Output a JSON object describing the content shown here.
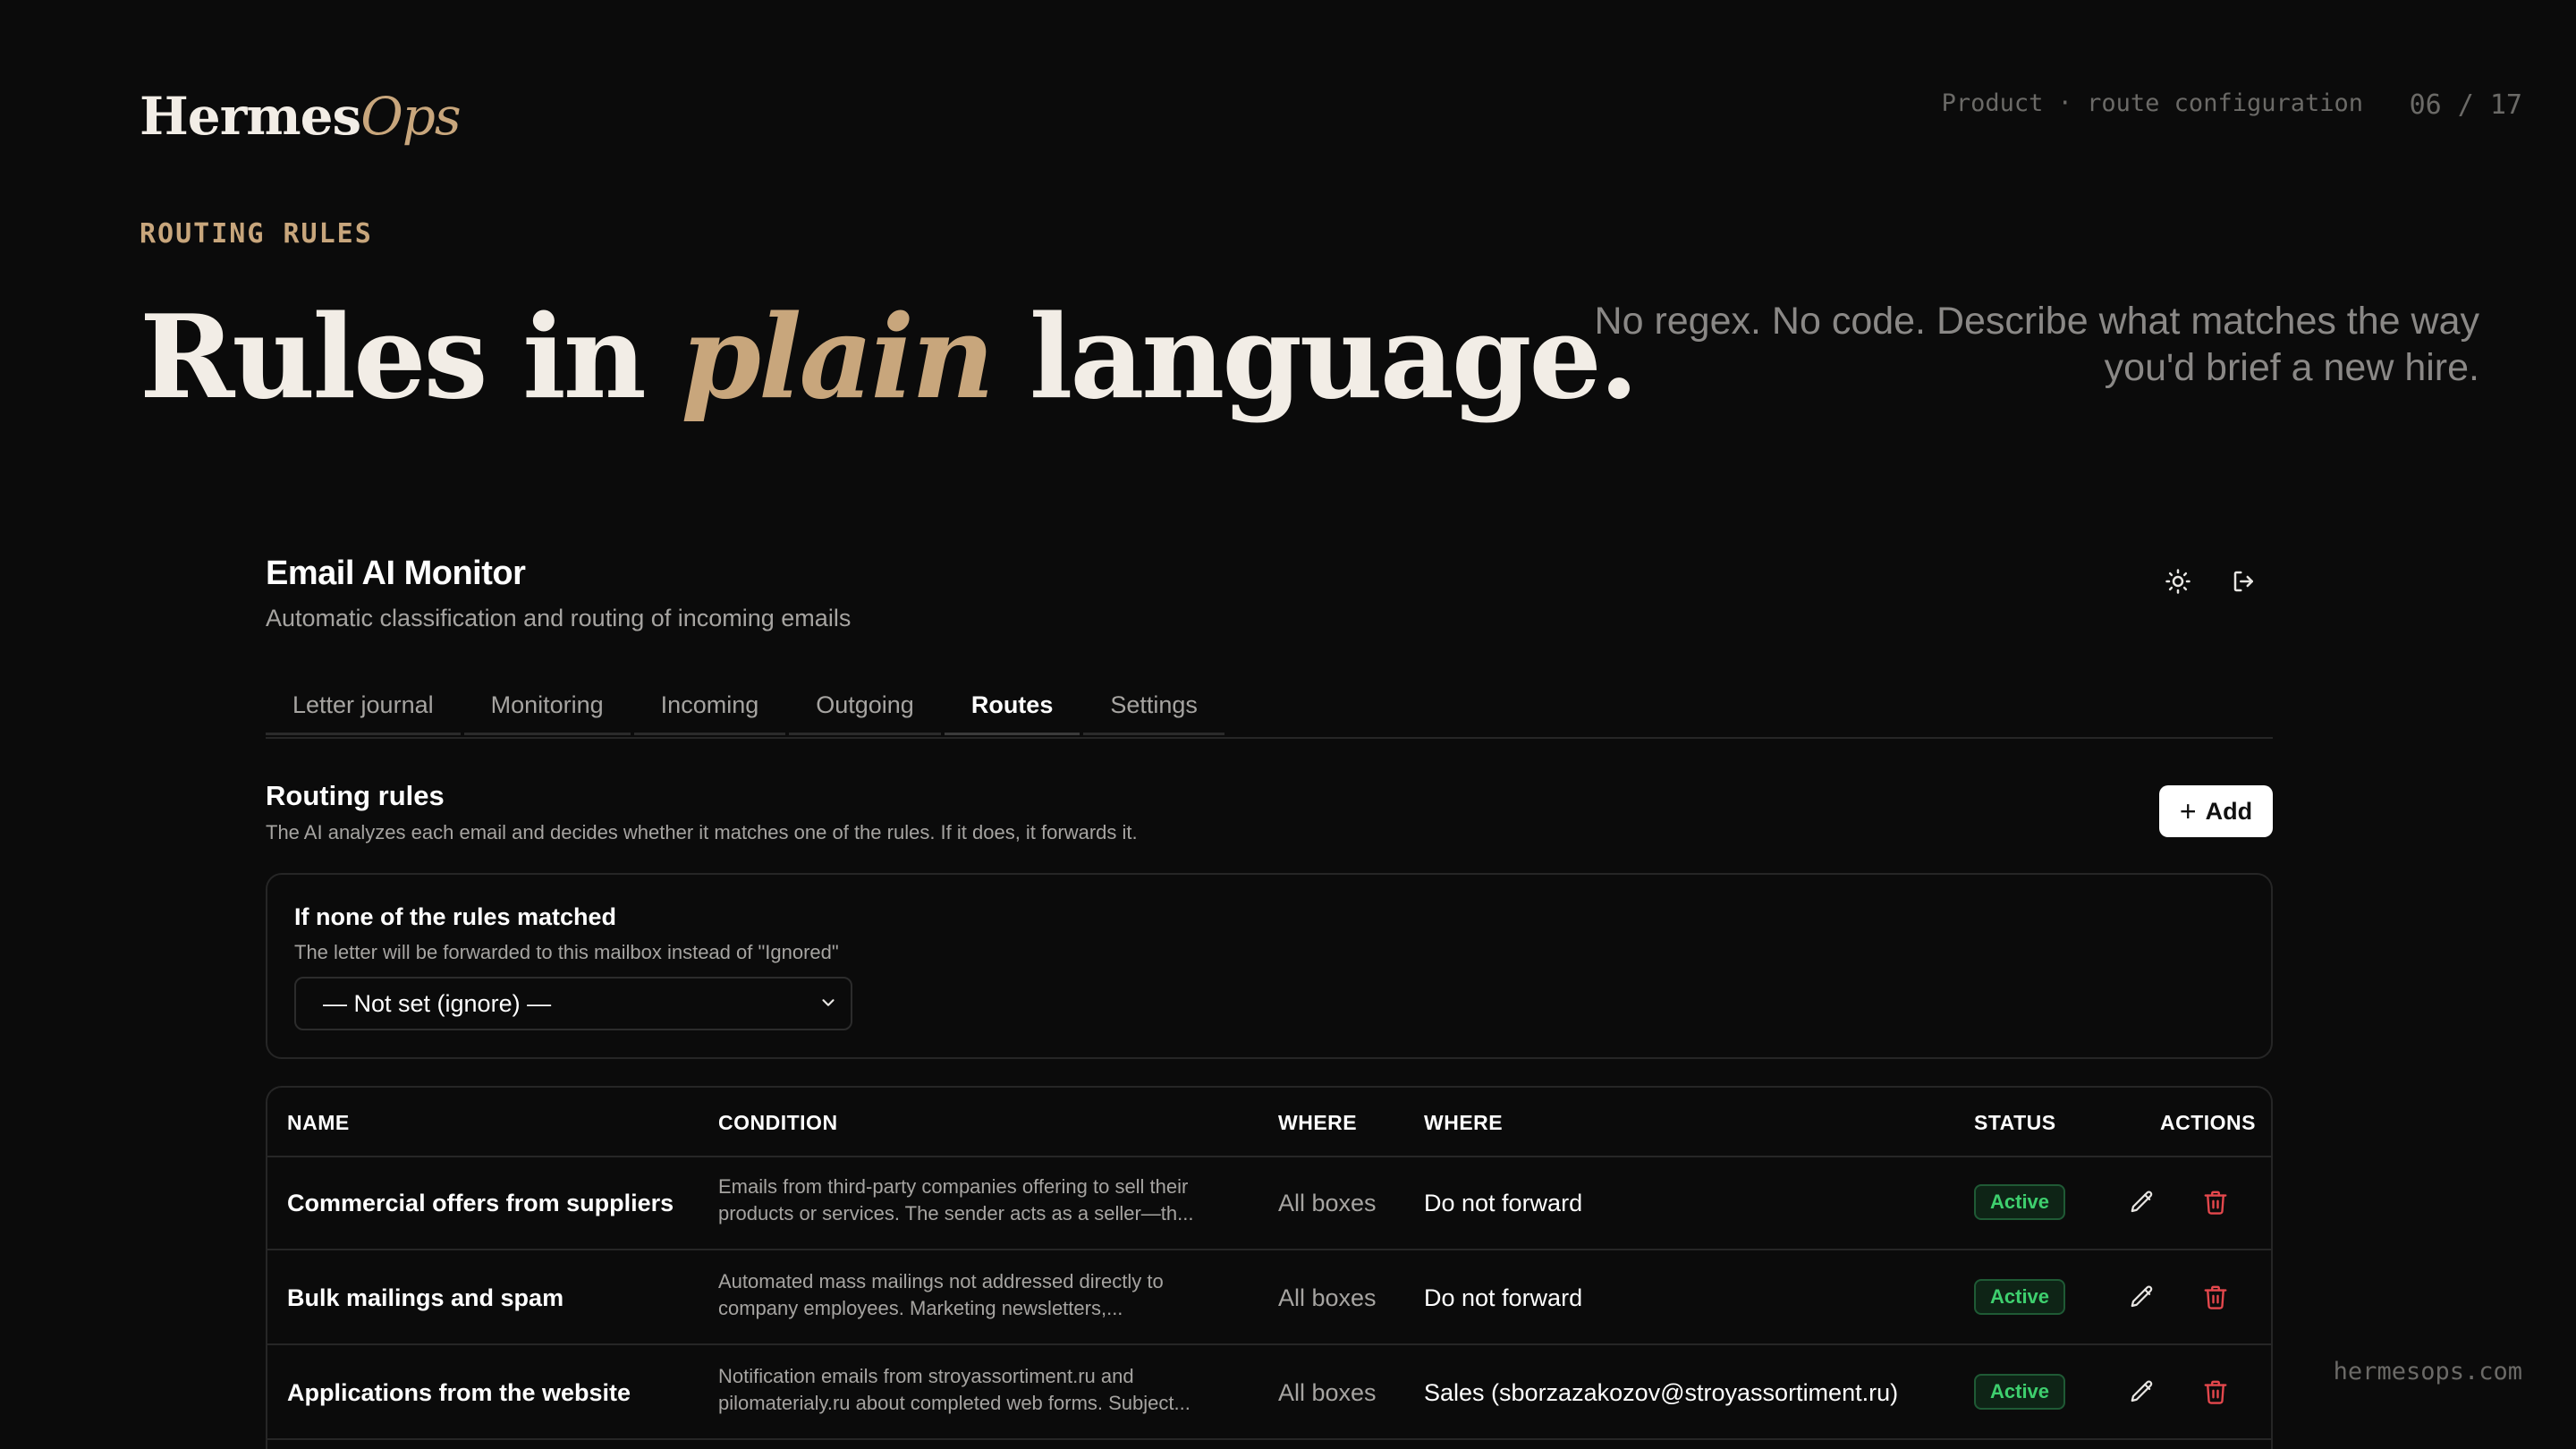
{
  "slide": {
    "brand_main": "Hermes",
    "brand_accent": "Ops",
    "breadcrumb": "Product · route configuration",
    "pager": "06 / 17",
    "eyebrow": "ROUTING RULES",
    "headline_pre": "Rules in ",
    "headline_accent": "plain",
    "headline_post": " language.",
    "lede": "No regex. No code. Describe what matches the way you'd brief a new hire.",
    "footer_url": "hermesops.com"
  },
  "app": {
    "title": "Email AI Monitor",
    "subtitle": "Automatic classification and routing of incoming emails",
    "header_icons": [
      "sun-icon",
      "logout-icon"
    ],
    "tabs": [
      {
        "label": "Letter journal"
      },
      {
        "label": "Monitoring"
      },
      {
        "label": "Incoming"
      },
      {
        "label": "Outgoing"
      },
      {
        "label": "Routes",
        "active": true
      },
      {
        "label": "Settings"
      }
    ],
    "section": {
      "title": "Routing rules",
      "subtitle": "The AI analyzes each email and decides whether it matches one of the rules. If it does, it forwards it.",
      "add_label": "Add"
    },
    "fallback": {
      "title": "If none of the rules matched",
      "subtitle": "The letter will be forwarded to this mailbox instead of \"Ignored\"",
      "selected": "— Not set (ignore) —"
    },
    "table": {
      "headers": {
        "name": "NAME",
        "condition": "CONDITION",
        "where_from": "WHERE",
        "where_to": "WHERE",
        "status": "STATUS",
        "actions": "ACTIONS"
      },
      "rows": [
        {
          "name": "Commercial offers from suppliers",
          "condition": "Emails from third-party companies offering to sell their products or services. The sender acts as a seller—th...",
          "mailbox": "All boxes",
          "destination": "Do not forward",
          "status": "Active"
        },
        {
          "name": "Bulk mailings and spam",
          "condition": "Automated mass mailings not addressed directly to company employees. Marketing newsletters,...",
          "mailbox": "All boxes",
          "destination": "Do not forward",
          "status": "Active"
        },
        {
          "name": "Applications from the website",
          "condition": "Notification emails from stroyassortiment.ru and pilomaterialy.ru about completed web forms. Subject...",
          "mailbox": "All boxes",
          "destination": "Sales (sborzazakozov@stroyassortiment.ru)",
          "status": "Active"
        }
      ]
    }
  },
  "colors": {
    "background": "#0b0b0b",
    "accent_gold": "#c8a67c",
    "status_active": "#3ecf6e",
    "delete_red": "#e5484d"
  }
}
